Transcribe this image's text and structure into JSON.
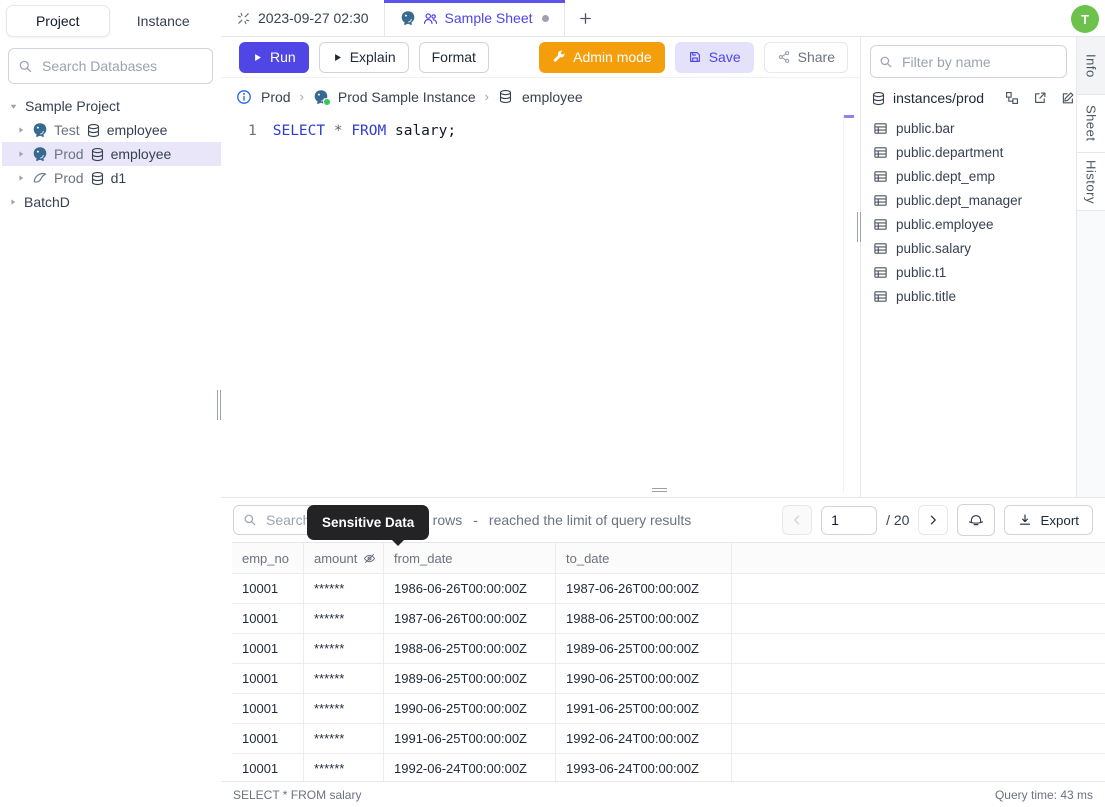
{
  "app": {
    "avatar_initial": "T"
  },
  "colors": {
    "accent_indigo": "#4f46e5",
    "admin_orange": "#f59e0b",
    "save_bg": "#e4e1fa",
    "avatar_green": "#6cc24a",
    "tooltip_bg": "#232326",
    "postgres_blue": "#38698f",
    "selected_row_bg": "#e9e6fa",
    "status_green": "#34c759"
  },
  "left_sidebar": {
    "tabs": [
      {
        "label": "Project"
      },
      {
        "label": "Instance"
      }
    ],
    "search_placeholder": "Search Databases",
    "tree": {
      "root_label": "Sample Project",
      "items": [
        {
          "env": "Test",
          "db": "employee",
          "engine": "postgres"
        },
        {
          "env": "Prod",
          "db": "employee",
          "engine": "postgres",
          "selected": true
        },
        {
          "env": "Prod",
          "db": "d1",
          "engine": "mysql"
        }
      ],
      "collapsed_label": "BatchD"
    }
  },
  "tab_bar": {
    "tabs": [
      {
        "label": "2023-09-27 02:30"
      },
      {
        "label": "Sample Sheet",
        "active": true,
        "dirty": true
      }
    ],
    "new_tab": "+"
  },
  "toolbar": {
    "run_label": "Run",
    "explain_label": "Explain",
    "format_label": "Format",
    "admin_label": "Admin mode",
    "save_label": "Save",
    "share_label": "Share"
  },
  "breadcrumb": {
    "env": "Prod",
    "instance": "Prod Sample Instance",
    "database": "employee"
  },
  "editor": {
    "line_number": "1",
    "sql": {
      "kw1": "SELECT",
      "star": "*",
      "kw2": "FROM",
      "rest": "salary;"
    }
  },
  "right_sidebar": {
    "filter_placeholder": "Filter by name",
    "connection": "instances/prod",
    "tables": [
      "public.bar",
      "public.department",
      "public.dept_emp",
      "public.dept_manager",
      "public.employee",
      "public.salary",
      "public.t1",
      "public.title"
    ]
  },
  "side_strip": {
    "tabs": [
      "Info",
      "Sheet",
      "History"
    ]
  },
  "results": {
    "search_placeholder": "Search",
    "tooltip": "Sensitive Data",
    "row_count": "0 rows",
    "separator": "-",
    "limit_note": "reached the limit of query results",
    "pagination": {
      "page": "1",
      "total": "/ 20"
    },
    "export_label": "Export",
    "table": {
      "headers": [
        "emp_no",
        "amount",
        "from_date",
        "to_date"
      ],
      "rows": [
        [
          "10001",
          "******",
          "1986-06-26T00:00:00Z",
          "1987-06-26T00:00:00Z"
        ],
        [
          "10001",
          "******",
          "1987-06-26T00:00:00Z",
          "1988-06-25T00:00:00Z"
        ],
        [
          "10001",
          "******",
          "1988-06-25T00:00:00Z",
          "1989-06-25T00:00:00Z"
        ],
        [
          "10001",
          "******",
          "1989-06-25T00:00:00Z",
          "1990-06-25T00:00:00Z"
        ],
        [
          "10001",
          "******",
          "1990-06-25T00:00:00Z",
          "1991-06-25T00:00:00Z"
        ],
        [
          "10001",
          "******",
          "1991-06-25T00:00:00Z",
          "1992-06-24T00:00:00Z"
        ],
        [
          "10001",
          "******",
          "1992-06-24T00:00:00Z",
          "1993-06-24T00:00:00Z"
        ]
      ]
    },
    "footer": {
      "statement": "SELECT * FROM salary",
      "query_time": "Query time: 43 ms"
    }
  }
}
